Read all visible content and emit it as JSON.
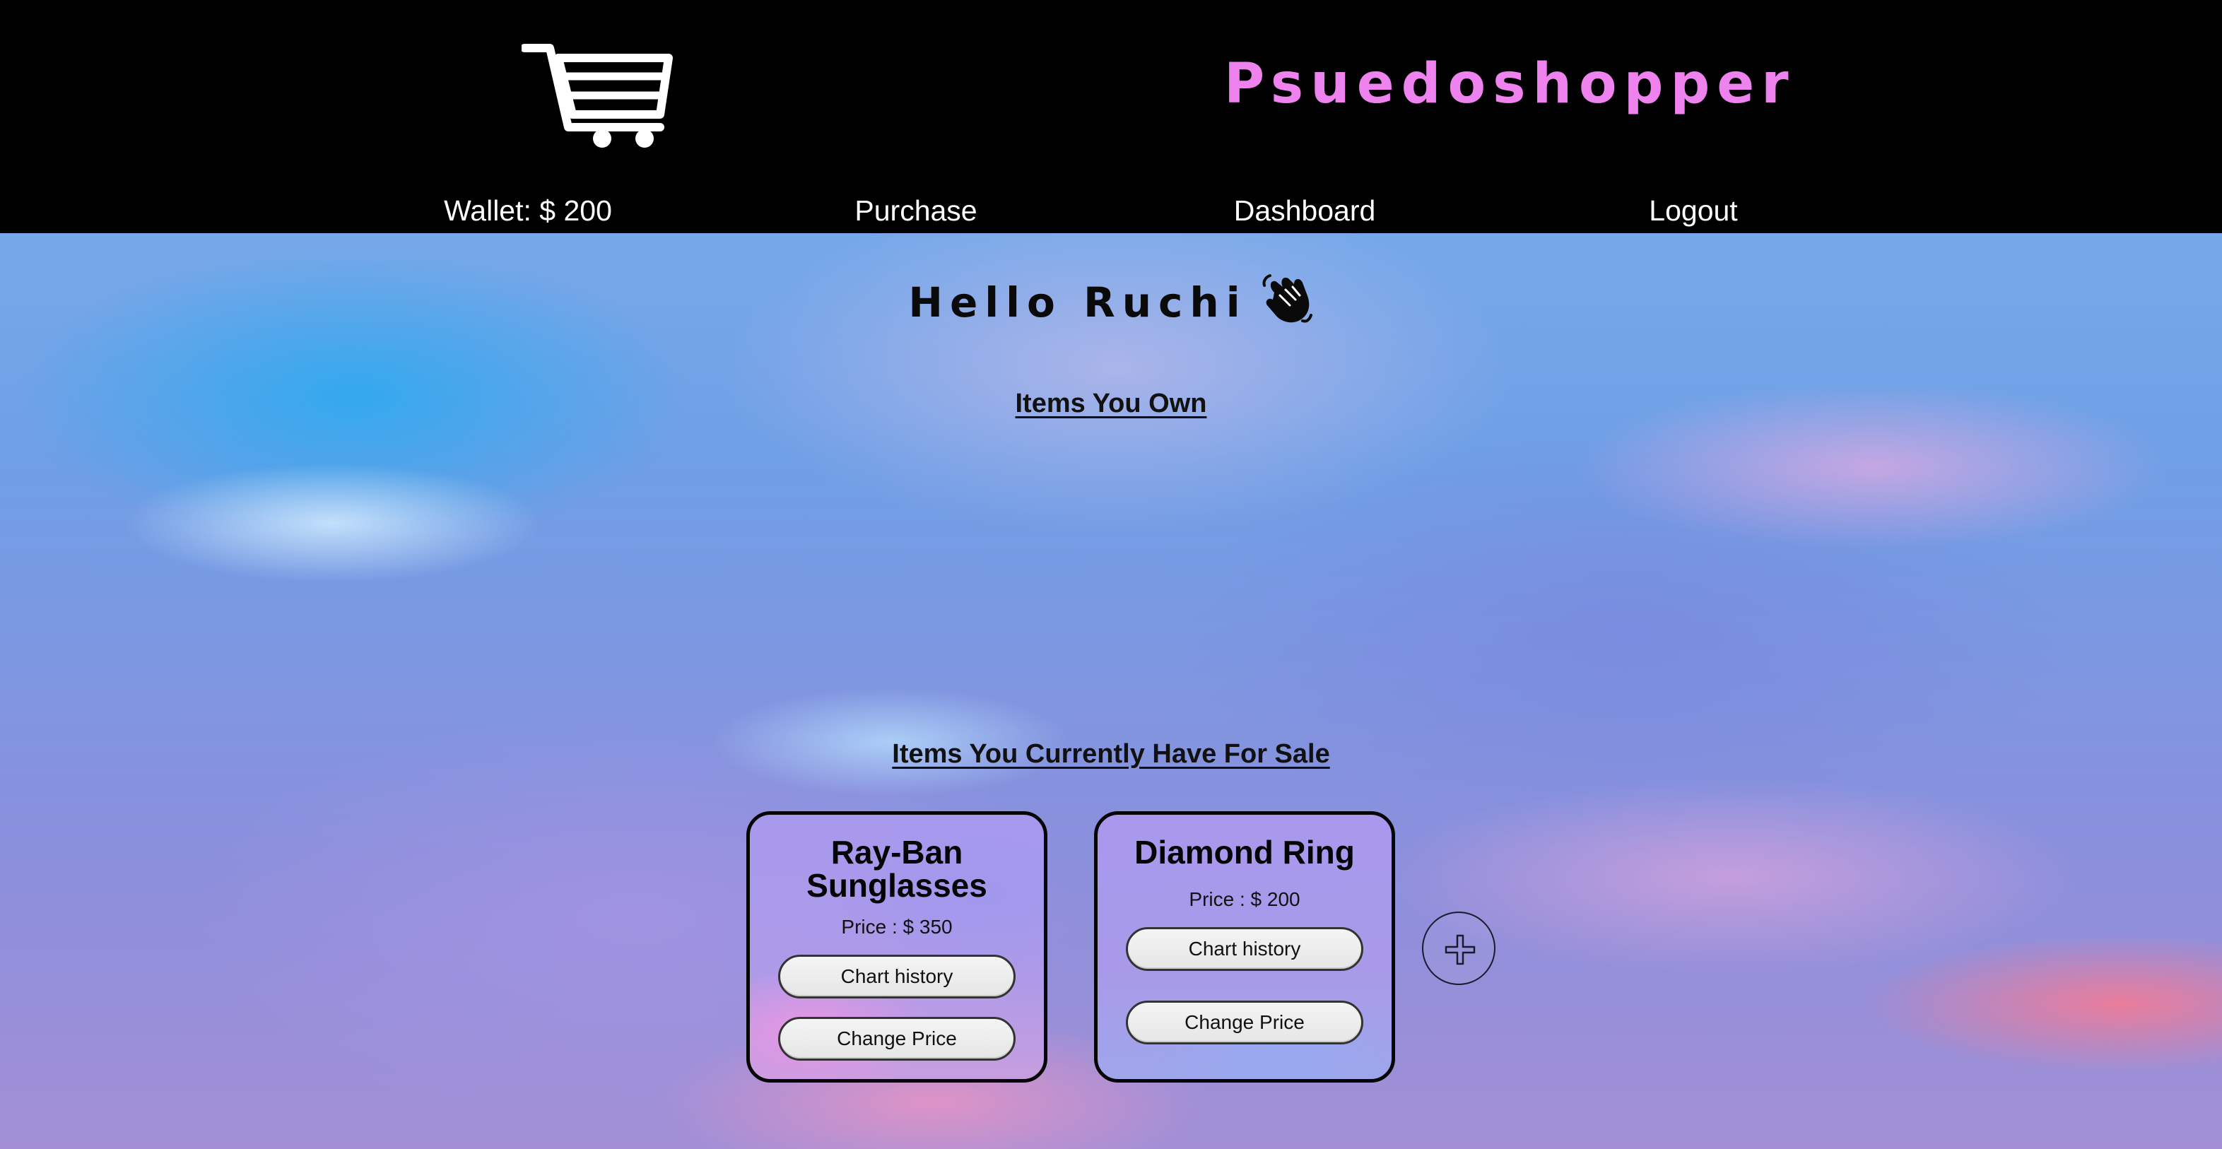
{
  "header": {
    "logo_icon": "shopping-cart-icon",
    "brand": "Psuedoshopper",
    "brand_color": "#ee82ee",
    "background": "#000000"
  },
  "nav": {
    "wallet": "Wallet: $ 200",
    "purchase": "Purchase",
    "dashboard": "Dashboard",
    "logout": "Logout"
  },
  "main": {
    "greeting": "Hello Ruchi",
    "greeting_icon": "waving-hand-icon",
    "owned_title": "Items You Own",
    "owned_items": [],
    "sale_title": "Items You Currently Have For Sale",
    "sale_items": [
      {
        "name": "Ray-Ban Sunglasses",
        "price": "Price : $ 350",
        "chart_label": "Chart history",
        "change_label": "Change Price"
      },
      {
        "name": "Diamond Ring",
        "price": "Price : $ 200",
        "chart_label": "Chart history",
        "change_label": "Change Price"
      }
    ],
    "add_icon": "plus-icon"
  }
}
